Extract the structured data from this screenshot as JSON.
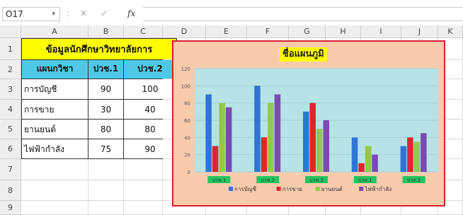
{
  "formula_bar": {
    "cell_ref": "O17",
    "dropdown_glyph": "▾",
    "sep_glyph": ":",
    "cancel_glyph": "✕",
    "enter_glyph": "✓",
    "fx_label": "fx",
    "formula": ""
  },
  "columns": [
    "A",
    "B",
    "C",
    "D",
    "E",
    "F",
    "G",
    "H",
    "I",
    "J",
    "K"
  ],
  "rows": [
    "1",
    "2",
    "3",
    "4",
    "5",
    "6",
    "7",
    "8",
    "9"
  ],
  "sheet": {
    "title": "ข้อมูลนักศึกษาวิทยาลัยการ",
    "headers": [
      "แผนกวิชา",
      "ปวช.1",
      "ปวช.2"
    ],
    "data_rows": [
      {
        "dept": "การบัญชี",
        "y1": "90",
        "y2": "100"
      },
      {
        "dept": "การขาย",
        "y1": "30",
        "y2": "40"
      },
      {
        "dept": "ยานยนต์",
        "y1": "80",
        "y2": "80"
      },
      {
        "dept": "ไฟฟ้ากำลัง",
        "y1": "75",
        "y2": "90"
      }
    ]
  },
  "chart_data": {
    "type": "bar",
    "title": "ชื่อแผนภูมิ",
    "categories": [
      "ปวช.1",
      "ปวช.2",
      "ปวช.3",
      "ปวส.1",
      "ปวส.2"
    ],
    "series": [
      {
        "name": "การบัญชี",
        "color": "#2e75d6",
        "values": [
          90,
          100,
          70,
          40,
          30
        ]
      },
      {
        "name": "การขาย",
        "color": "#e0252f",
        "values": [
          30,
          40,
          80,
          10,
          40
        ]
      },
      {
        "name": "ยานยนต์",
        "color": "#92c94a",
        "values": [
          80,
          80,
          50,
          30,
          35
        ]
      },
      {
        "name": "ไฟฟ้ากำลัง",
        "color": "#7a4ab0",
        "values": [
          75,
          90,
          60,
          20,
          45
        ]
      }
    ],
    "ylim": [
      0,
      120
    ],
    "yticks": [
      "0",
      "20",
      "40",
      "60",
      "80",
      "100",
      "120"
    ],
    "grid": true,
    "legend": "bottom",
    "plot_bg": "#b7e3e6",
    "cat_label_bg": "#22c55e"
  }
}
